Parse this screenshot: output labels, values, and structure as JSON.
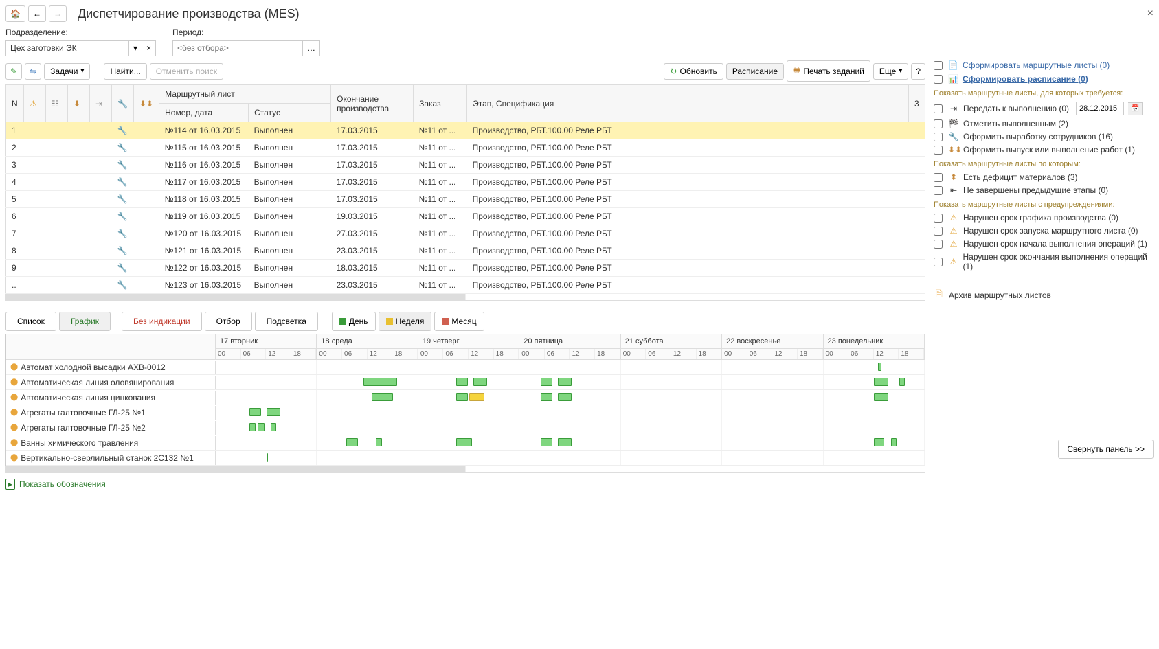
{
  "header": {
    "title": "Диспетчирование производства (MES)"
  },
  "filters": {
    "subdivision_label": "Подразделение:",
    "subdivision_value": "Цех заготовки ЭК",
    "period_label": "Период:",
    "period_placeholder": "<без отбора>"
  },
  "topButtons": {
    "refresh": "Обновить",
    "schedule": "Расписание",
    "print_jobs": "Печать заданий",
    "more": "Еще",
    "tasks": "Задачи",
    "find": "Найти...",
    "cancel_search": "Отменить поиск"
  },
  "tableHeaders": {
    "n": "N",
    "route_sheet": "Маршрутный лист",
    "number_date": "Номер, дата",
    "status": "Статус",
    "end_production": "Окончание производства",
    "order": "Заказ",
    "stage_spec": "Этап, Спецификация",
    "three": "3"
  },
  "rows": [
    {
      "n": "1",
      "num": "№114 от 16.03.2015",
      "status": "Выполнен",
      "end": "17.03.2015",
      "order": "№11 от ...",
      "spec": "Производство, РБТ.100.00 Реле РБТ"
    },
    {
      "n": "2",
      "num": "№115 от 16.03.2015",
      "status": "Выполнен",
      "end": "17.03.2015",
      "order": "№11 от ...",
      "spec": "Производство, РБТ.100.00 Реле РБТ"
    },
    {
      "n": "3",
      "num": "№116 от 16.03.2015",
      "status": "Выполнен",
      "end": "17.03.2015",
      "order": "№11 от ...",
      "spec": "Производство, РБТ.100.00 Реле РБТ"
    },
    {
      "n": "4",
      "num": "№117 от 16.03.2015",
      "status": "Выполнен",
      "end": "17.03.2015",
      "order": "№11 от ...",
      "spec": "Производство, РБТ.100.00 Реле РБТ"
    },
    {
      "n": "5",
      "num": "№118 от 16.03.2015",
      "status": "Выполнен",
      "end": "17.03.2015",
      "order": "№11 от ...",
      "spec": "Производство, РБТ.100.00 Реле РБТ"
    },
    {
      "n": "6",
      "num": "№119 от 16.03.2015",
      "status": "Выполнен",
      "end": "19.03.2015",
      "order": "№11 от ...",
      "spec": "Производство, РБТ.100.00 Реле РБТ"
    },
    {
      "n": "7",
      "num": "№120 от 16.03.2015",
      "status": "Выполнен",
      "end": "27.03.2015",
      "order": "№11 от ...",
      "spec": "Производство, РБТ.100.00 Реле РБТ"
    },
    {
      "n": "8",
      "num": "№121 от 16.03.2015",
      "status": "Выполнен",
      "end": "23.03.2015",
      "order": "№11 от ...",
      "spec": "Производство, РБТ.100.00 Реле РБТ"
    },
    {
      "n": "9",
      "num": "№122 от 16.03.2015",
      "status": "Выполнен",
      "end": "18.03.2015",
      "order": "№11 от ...",
      "spec": "Производство, РБТ.100.00 Реле РБТ"
    },
    {
      "n": "..",
      "num": "№123 от 16.03.2015",
      "status": "Выполнен",
      "end": "23.03.2015",
      "order": "№11 от ...",
      "spec": "Производство, РБТ.100.00 Реле РБТ"
    }
  ],
  "viewTabs": {
    "list": "Список",
    "chart": "График",
    "no_indication": "Без индикации",
    "selection": "Отбор",
    "highlight": "Подсветка",
    "day": "День",
    "week": "Неделя",
    "month": "Месяц"
  },
  "gantt": {
    "days": [
      "17 вторник",
      "18 среда",
      "19 четверг",
      "20 пятница",
      "21 суббота",
      "22 воскресенье",
      "23 понедельник"
    ],
    "hours": [
      "00",
      "06",
      "12",
      "18"
    ],
    "resources": [
      "Автомат холодной высадки АХВ-0012",
      "Автоматическая линия оловянирования",
      "Автоматическая линия цинкования",
      "Агрегаты галтовочные ГЛ-25 №1",
      "Агрегаты галтовочные ГЛ-25 №2",
      "Ванны химического травления",
      "Вертикально-сверлильный станок 2С132 №1"
    ]
  },
  "rightPanel": {
    "form_route_sheets": "Сформировать маршрутные листы (0)",
    "form_schedule": "Сформировать расписание (0)",
    "section1": "Показать маршрутные листы, для которых требуется:",
    "transfer": "Передать к выполнению (0)",
    "transfer_date": "28.12.2015",
    "mark_done": "Отметить выполненным (2)",
    "register_output": "Оформить выработку сотрудников (16)",
    "register_release": "Оформить выпуск или выполнение работ (1)",
    "section2": "Показать маршрутные листы по которым:",
    "deficit": "Есть дефицит материалов (3)",
    "prev_stages": "Не завершены предыдущие этапы (0)",
    "section3": "Показать маршрутные листы с предупреждениями:",
    "warn_schedule": "Нарушен срок графика производства (0)",
    "warn_start_route": "Нарушен срок запуска маршрутного листа (0)",
    "warn_start_ops": "Нарушен срок начала выполнения операций (1)",
    "warn_end_ops": "Нарушен срок окончания выполнения операций (1)",
    "archive": "Архив маршрутных листов"
  },
  "bottom": {
    "designations": "Показать обозначения",
    "collapse": "Свернуть панель >>"
  }
}
